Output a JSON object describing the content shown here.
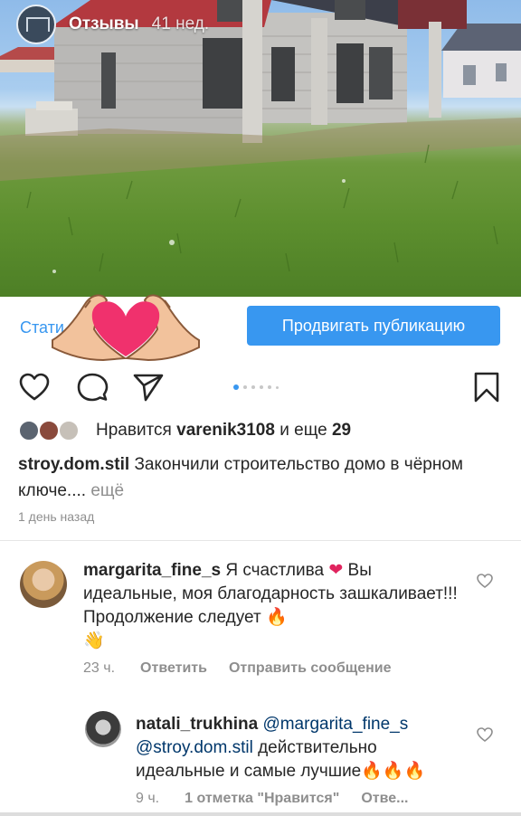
{
  "story": {
    "title": "Отзывы",
    "time": "41 нед."
  },
  "insights": {
    "stats_label": "Стати",
    "promote_label": "Продвигать публикацию"
  },
  "likes": {
    "prefix": "Нравится",
    "user": "varenik3108",
    "connector": "и еще",
    "count": "29"
  },
  "post": {
    "username": "stroy.dom.stil",
    "caption": "Закончили строительство домо в чёрном ключе....",
    "more": "ещё",
    "date": "1 день назад"
  },
  "comments": [
    {
      "username": "margarita_fine_s",
      "text_1": "Я счастлива",
      "text_2": "Вы идеальные,  моя благодарность зашкаливает!!! Продолжение следует",
      "time": "23 ч.",
      "reply": "Ответить",
      "send": "Отправить сообщение"
    },
    {
      "username": "natali_trukhina",
      "mention_1": "@margarita_fine_s",
      "mention_2": "@stroy.dom.stil",
      "text": "действительно идеальные и самые лучшие",
      "time": "9 ч.",
      "likes": "1 отметка \"Нравится\"",
      "reply": "Отве..."
    }
  ],
  "icons": {
    "like": "heart-outline-icon",
    "comment": "speech-bubble-icon",
    "share": "paper-plane-icon",
    "save": "bookmark-icon",
    "carousel_dots": 6
  },
  "colors": {
    "accent": "#3897f0",
    "text": "#262626",
    "muted": "#8e8e8e",
    "heart_sticker": "#f0316d"
  }
}
